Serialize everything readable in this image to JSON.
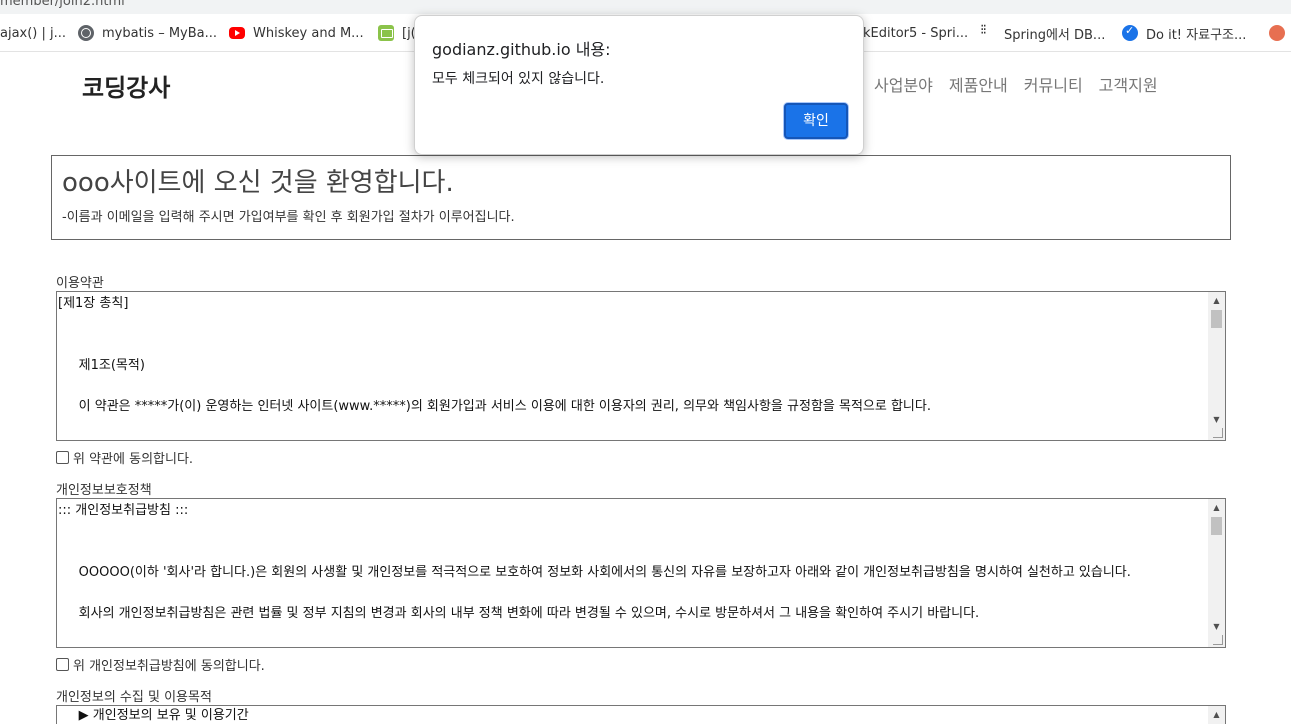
{
  "browser": {
    "url": "member/join2.html",
    "bookmarks": [
      {
        "label": "ajax() | j...",
        "icon": "none"
      },
      {
        "label": "mybatis – MyBa...",
        "icon": "globe-icon"
      },
      {
        "label": "Whiskey and M...",
        "icon": "youtube-icon"
      },
      {
        "label": "[j(",
        "icon": "green-note-icon"
      },
      {
        "label": "kEditor5 - Spri...",
        "icon": "none"
      },
      {
        "label": "Spring에서 DB...",
        "icon": "dots-icon"
      },
      {
        "label": "Do it! 자료구조...",
        "icon": "blue-check-icon"
      }
    ]
  },
  "header": {
    "logo": "코딩강사",
    "nav": [
      "사업분야",
      "제품안내",
      "커뮤니티",
      "고객지원"
    ]
  },
  "welcome": {
    "title": "ooo사이트에 오신 것을 환영합니다.",
    "subtitle": "-이름과 이메일을 입력해 주시면 가입여부를 확인 후 회원가입 절차가 이루어집니다."
  },
  "terms": {
    "label": "이용약관",
    "line1": "[제1장 총칙]",
    "line2": "     제1조(목적)",
    "line3": "     이 약관은 *****가(이) 운영하는 인터넷 사이트(www.*****)의 회원가입과 서비스 이용에 대한 이용자의 권리, 의무와 책임사항을 규정함을 목적으로 합니다.",
    "agree": "위 약관에 동의합니다."
  },
  "privacy": {
    "label": "개인정보보호정책",
    "line1": "::: 개인정보취급방침 :::",
    "line2": "     OOOOO(이하 '회사'라 합니다.)은 회원의 사생활 및 개인정보를 적극적으로 보호하여 정보화 사회에서의 통신의 자유를 보장하고자 아래와 같이 개인정보취급방침을 명시하여 실천하고 있습니다.",
    "line3": "     회사의 개인정보취급방침은 관련 법률 및 정부 지침의 변경과 회사의 내부 정책 변화에 따라 변경될 수 있으며, 수시로 방문하셔서 그 내용을 확인하여 주시기 바랍니다.",
    "agree": "위 개인정보취급방침에 동의합니다."
  },
  "collection": {
    "label": "개인정보의 수집 및 이용목적",
    "line1": "     ▶ 개인정보의 보유 및 이용기간"
  },
  "dialog": {
    "title": "godianz.github.io 내용:",
    "message": "모두 체크되어 있지 않습니다.",
    "ok": "확인"
  }
}
